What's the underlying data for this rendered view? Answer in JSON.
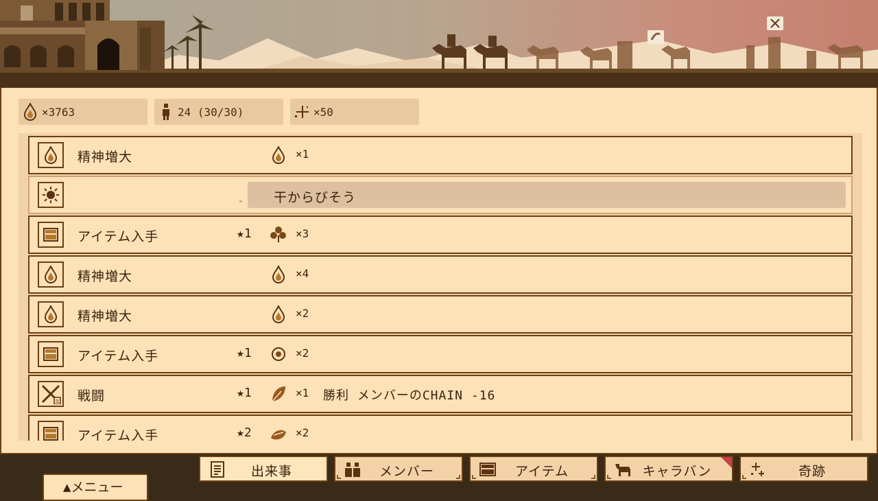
{
  "resources": {
    "spirit": {
      "icon": "drop-icon",
      "text": "×3763"
    },
    "members": {
      "icon": "person-icon",
      "text": "24 (30/30)"
    },
    "miracles": {
      "icon": "sparkle-icon",
      "text": "×50"
    }
  },
  "events": [
    {
      "type": "spirit",
      "icon": "drop-icon",
      "label": "精神増大",
      "stars": "",
      "reward_icon": "drop-icon",
      "qty": "×1",
      "note": ""
    },
    {
      "type": "weather",
      "icon": "sun-icon",
      "label": "",
      "stars": "",
      "reward_icon": "",
      "qty": "",
      "note": "",
      "tooltip": "干からびそう"
    },
    {
      "type": "item",
      "icon": "chest-icon",
      "label": "アイテム入手",
      "stars": "★1",
      "reward_icon": "herb-icon",
      "qty": "×3",
      "note": ""
    },
    {
      "type": "spirit",
      "icon": "drop-icon",
      "label": "精神増大",
      "stars": "",
      "reward_icon": "drop-icon",
      "qty": "×4",
      "note": ""
    },
    {
      "type": "spirit",
      "icon": "drop-icon",
      "label": "精神増大",
      "stars": "",
      "reward_icon": "drop-icon",
      "qty": "×2",
      "note": ""
    },
    {
      "type": "item",
      "icon": "chest-icon",
      "label": "アイテム入手",
      "stars": "★1",
      "reward_icon": "orb-icon",
      "qty": "×2",
      "note": ""
    },
    {
      "type": "battle",
      "icon": "crossed-swords-icon",
      "label": "戦闘",
      "stars": "★1",
      "reward_icon": "leaf-icon",
      "qty": "×1",
      "note": "勝利 メンバーのCHAIN -16"
    },
    {
      "type": "item",
      "icon": "chest-icon",
      "label": "アイテム入手",
      "stars": "★2",
      "reward_icon": "nest-icon",
      "qty": "×2",
      "note": ""
    }
  ],
  "menu_button": "▲メニュー",
  "tabs": [
    {
      "label": "出来事",
      "icon": "document-icon",
      "active": true,
      "notification": false
    },
    {
      "label": "メンバー",
      "icon": "people-icon",
      "active": false,
      "notification": false
    },
    {
      "label": "アイテム",
      "icon": "chest-icon",
      "active": false,
      "notification": false
    },
    {
      "label": "キャラバン",
      "icon": "camel-icon",
      "active": false,
      "notification": true
    },
    {
      "label": "奇跡",
      "icon": "sparkle-icon",
      "active": false,
      "notification": false
    }
  ],
  "colors": {
    "panel": "#fde1b7",
    "border": "#6b3f12",
    "text": "#3b2410",
    "stat_bg": "#e8c9a0",
    "tooltip_bg": "#dcc0a0",
    "notification": "#c7414a"
  }
}
